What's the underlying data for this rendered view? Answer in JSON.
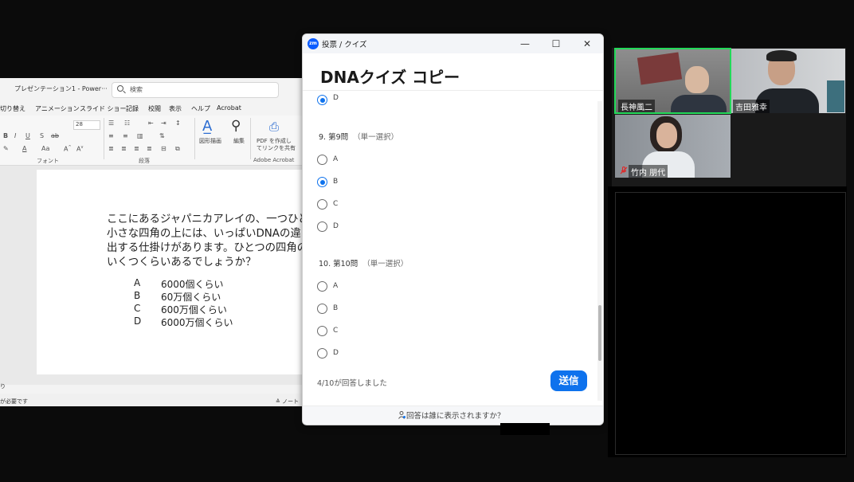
{
  "ppt": {
    "doc_title": "プレゼンテーション1 - Power···",
    "search_placeholder": "検索",
    "menu": [
      "切り替え",
      "アニメーション",
      "スライド ショー",
      "記録",
      "校閲",
      "表示",
      "ヘルプ",
      "Acrobat"
    ],
    "ribbon": {
      "font_size": "28",
      "font_group": "フォント",
      "paragraph_group": "段落",
      "adobe_group": "Adobe Acrobat",
      "shape_label": "図形描画",
      "edit_label": "編集",
      "pdf_label_1": "PDF を作成し",
      "pdf_label_2": "てリンクを共有"
    },
    "slide": {
      "lines": [
        "ここにあるジャパニカアレイの、一つひと",
        "小さな四角の上には、いっぱいDNAの違い",
        "出する仕掛けがあります。ひとつの四角の",
        "いくつくらいあるでしょうか？"
      ],
      "options": [
        {
          "letter": "A",
          "text": "6000個くらい"
        },
        {
          "letter": "B",
          "text": "60万個くらい"
        },
        {
          "letter": "C",
          "text": "600万個くらい"
        },
        {
          "letter": "D",
          "text": "6000万個くらい"
        }
      ]
    },
    "status_left": "が必要です",
    "notes_label": "ノート",
    "side_char": "り"
  },
  "poll": {
    "window_title": "投票 / クイズ",
    "app_badge": "zm",
    "title": "DNAクイズ コピー",
    "prev_partial_label": "D",
    "questions": [
      {
        "number": "9. 第9問",
        "type": "（単一選択）",
        "options": [
          "A",
          "B",
          "C",
          "D"
        ],
        "selected": 1
      },
      {
        "number": "10. 第10問",
        "type": "（単一選択）",
        "options": [
          "A",
          "B",
          "C",
          "D"
        ],
        "selected": -1
      }
    ],
    "answered": "4/10が回答しました",
    "submit_label": "送信",
    "footer_text": "回答は誰に表示されますか？"
  },
  "gallery": {
    "participants": [
      {
        "name": "長神風二",
        "speaking": true,
        "muted": false
      },
      {
        "name": "吉田雅幸",
        "speaking": false,
        "muted": false
      },
      {
        "name": "竹内 朋代",
        "speaking": false,
        "muted": true
      }
    ]
  },
  "colors": {
    "zoom_blue": "#0e72ed",
    "speaker_green": "#23d959",
    "background": "#0b0b0b"
  }
}
